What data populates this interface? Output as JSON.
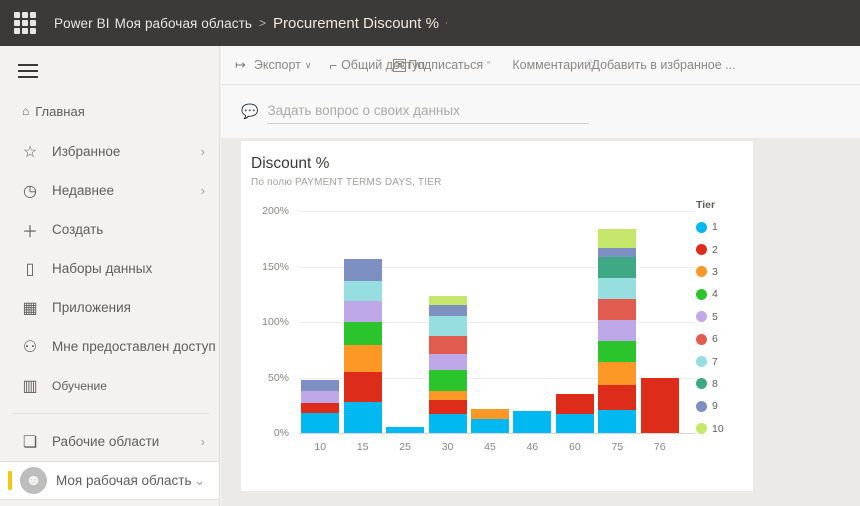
{
  "topbar": {
    "waffle_icon": "app-launcher-icon",
    "brand": "Power BI",
    "workspace_crumb": "Моя рабочая область",
    "crumb_separator": ">",
    "report_title": "Procurement Discount %",
    "title_tail": "∙"
  },
  "sidebar": {
    "hamburger_icon": "hamburger-icon",
    "home": {
      "icon": "home-icon",
      "glyph": "⌂",
      "label": "Главная"
    },
    "items": [
      {
        "label": "Избранное",
        "icon": "star-icon",
        "glyph": "☆",
        "chevron": "›",
        "small": false
      },
      {
        "label": "Недавнее",
        "icon": "clock-icon",
        "glyph": "◷",
        "chevron": "›",
        "small": false
      },
      {
        "label": "Создать",
        "icon": "plus-icon",
        "glyph": "＋",
        "chevron": "",
        "small": false
      },
      {
        "label": "Наборы данных",
        "icon": "database-icon",
        "glyph": "▯",
        "chevron": "",
        "small": false
      },
      {
        "label": "Приложения",
        "icon": "apps-grid-icon",
        "glyph": "▦",
        "chevron": "",
        "small": false
      },
      {
        "label": "Мне предоставлен доступ",
        "icon": "shared-user-icon",
        "glyph": "⚇",
        "chevron": "",
        "small": false
      },
      {
        "label": "Обучение",
        "icon": "book-icon",
        "glyph": "▥",
        "chevron": "",
        "small": true
      }
    ],
    "workspaces": {
      "label": "Рабочие области",
      "icon": "workspaces-icon",
      "glyph": "❏",
      "chevron": "›"
    },
    "my_workspace": {
      "label": "Моя рабочая область",
      "icon": "avatar-icon",
      "glyph": "☻",
      "chevron": "⌄"
    }
  },
  "toolbar": {
    "items": [
      {
        "name": "export-button",
        "glyph": "↦",
        "label": "Экспорт",
        "caret": "∨"
      },
      {
        "name": "share-button",
        "glyph": "⌐",
        "label": "Общий доступ",
        "caret": ""
      },
      {
        "name": "subscribe-button",
        "glyph": "✉",
        "label": "Подписаться",
        "caret": "\""
      },
      {
        "name": "comments-button",
        "glyph": "",
        "label": "Комментарии",
        "caret": ""
      },
      {
        "name": "favorite-button",
        "glyph": "✩",
        "label": "Добавить в избранное ...",
        "caret": ""
      }
    ]
  },
  "qa": {
    "icon": "chat-bubble-icon",
    "placeholder": "Задать вопрос о своих данных",
    "value": ""
  },
  "chart_data": {
    "type": "bar",
    "stacked": true,
    "title": "Discount %",
    "subtitle": "По полю PAYMENT TERMS DAYS, TIER",
    "xlabel": "",
    "ylabel": "",
    "categories": [
      "10",
      "15",
      "25",
      "30",
      "45",
      "46",
      "60",
      "75",
      "76"
    ],
    "ylim": [
      0,
      200
    ],
    "yticks": [
      "0%",
      "50%",
      "100%",
      "150%",
      "200%"
    ],
    "ytick_values": [
      0,
      50,
      100,
      150,
      200
    ],
    "grid": true,
    "legend": {
      "title": "Tier",
      "position": "right"
    },
    "series": [
      {
        "name": "1",
        "color": "#01b8f1",
        "values": [
          18,
          28,
          5,
          17,
          13,
          20,
          17,
          21,
          0
        ]
      },
      {
        "name": "2",
        "color": "#dd2c1a",
        "values": [
          9,
          27,
          0,
          13,
          0,
          0,
          18,
          22,
          50
        ]
      },
      {
        "name": "3",
        "color": "#fd9827",
        "values": [
          0,
          24,
          0,
          8,
          9,
          0,
          0,
          21,
          0
        ]
      },
      {
        "name": "4",
        "color": "#2cc42c",
        "values": [
          0,
          21,
          0,
          19,
          0,
          0,
          0,
          19,
          0
        ]
      },
      {
        "name": "5",
        "color": "#bfa8e8",
        "values": [
          11,
          19,
          0,
          14,
          0,
          0,
          0,
          19,
          0
        ]
      },
      {
        "name": "6",
        "color": "#e05c4e",
        "values": [
          0,
          0,
          0,
          16,
          0,
          0,
          0,
          19,
          0
        ]
      },
      {
        "name": "7",
        "color": "#96dee0",
        "values": [
          0,
          18,
          0,
          18,
          0,
          0,
          0,
          19,
          0
        ]
      },
      {
        "name": "8",
        "color": "#3fa885",
        "values": [
          0,
          0,
          0,
          0,
          0,
          0,
          0,
          19,
          0
        ]
      },
      {
        "name": "9",
        "color": "#7e8fc2",
        "values": [
          10,
          20,
          0,
          10,
          0,
          0,
          0,
          8,
          0
        ]
      },
      {
        "name": "10",
        "color": "#c5e86c",
        "values": [
          0,
          0,
          0,
          8,
          0,
          0,
          0,
          17,
          0
        ]
      }
    ]
  }
}
